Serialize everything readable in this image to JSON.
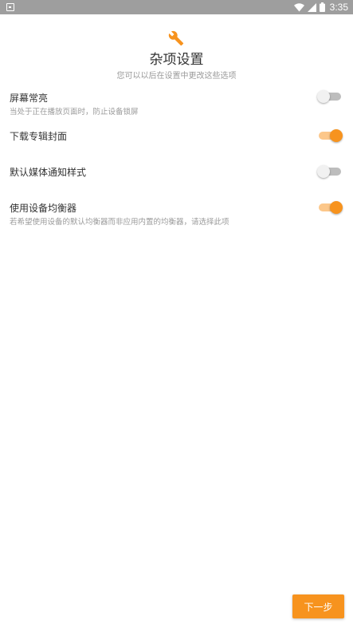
{
  "status_bar": {
    "time": "3:35"
  },
  "header": {
    "icon": "wrench-icon",
    "title": "杂项设置",
    "subtitle": "您可以以后在设置中更改这些选项"
  },
  "settings": [
    {
      "title": "屏幕常亮",
      "description": "当处于正在播放页面时，防止设备锁屏",
      "enabled": false
    },
    {
      "title": "下载专辑封面",
      "description": "",
      "enabled": true
    },
    {
      "title": "默认媒体通知样式",
      "description": "",
      "enabled": false
    },
    {
      "title": "使用设备均衡器",
      "description": "若希望使用设备的默认均衡器而非应用内置的均衡器，请选择此项",
      "enabled": true
    }
  ],
  "footer": {
    "next_label": "下一步"
  },
  "colors": {
    "accent": "#f7931e",
    "accent_track": "#fcc78a",
    "status_bar": "#9e9e9e"
  }
}
